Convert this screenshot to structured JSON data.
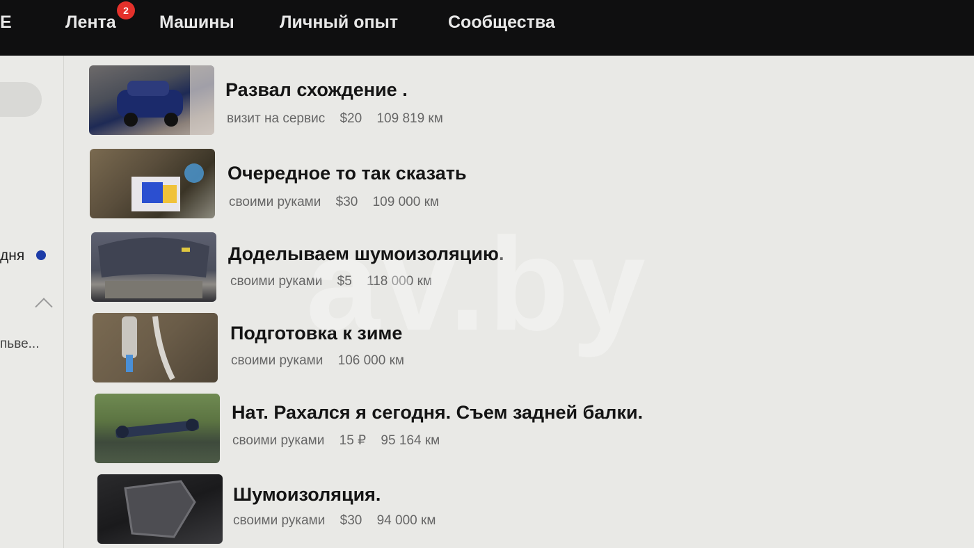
{
  "nav": {
    "partial_left": "E",
    "items": [
      {
        "label": "Лента",
        "badge": "2"
      },
      {
        "label": "Машины"
      },
      {
        "label": "Личный опыт"
      },
      {
        "label": "Сообщества"
      }
    ]
  },
  "sidebar": {
    "item_partial": "дня",
    "item_partial_2": "пьве..."
  },
  "entries": [
    {
      "title": "Развал схождение .",
      "type": "визит на сервис",
      "cost": "$20",
      "mileage": "109 819 км",
      "thumb_icon": "car-photo"
    },
    {
      "title": "Очередное то так сказать",
      "type": "своими руками",
      "cost": "$30",
      "mileage": "109 000 км",
      "thumb_icon": "parts-photo"
    },
    {
      "title": "Доделываем шумоизоляцию.",
      "type": "своими руками",
      "cost": "$5",
      "mileage": "118 000 км",
      "thumb_icon": "hood-photo"
    },
    {
      "title": "Подготовка к зиме",
      "type": "своими руками",
      "cost": "",
      "mileage": "106 000 км",
      "thumb_icon": "exhaust-photo"
    },
    {
      "title": "Нат. Рахался я сегодня. Съем задней балки.",
      "type": "своими руками",
      "cost": "15 ₽",
      "mileage": "95 164 км",
      "thumb_icon": "beam-photo"
    },
    {
      "title": "Шумоизоляция.",
      "type": "своими руками",
      "cost": "$30",
      "mileage": "94 000 км",
      "thumb_icon": "insulation-photo"
    }
  ],
  "watermark": "av.by",
  "colors": {
    "topbar": "#0f0f10",
    "badge": "#e4312b",
    "dot": "#1d3ca8"
  }
}
